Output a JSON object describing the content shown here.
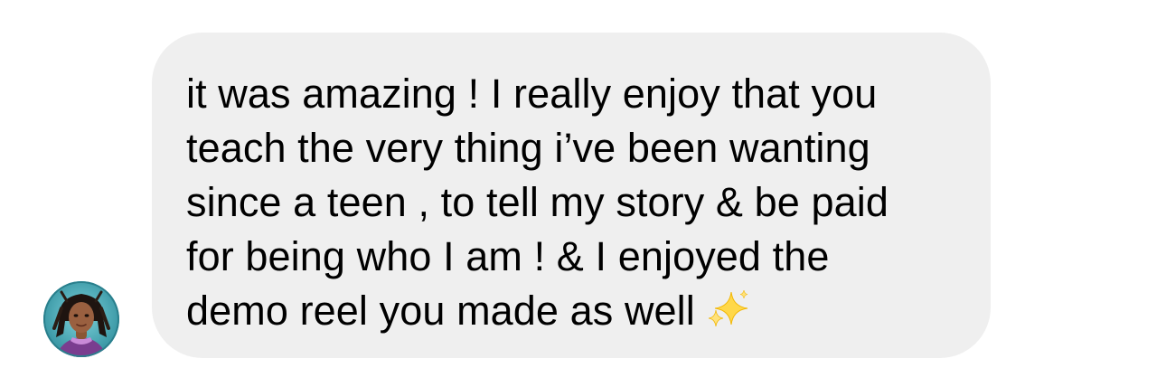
{
  "message": {
    "lines": [
      "it was amazing ! I really enjoy that you",
      "teach the very thing i’ve been wanting",
      "since a teen , to tell my story & be paid",
      "for being who I am ! & I enjoyed the",
      "demo reel you made as well"
    ],
    "emoji": "sparkles-icon",
    "bubble_color": "#efefef",
    "text_color": "#000000"
  },
  "sender": {
    "avatar": "avatar-illustration",
    "avatar_ring_color": "#3fa3b0"
  }
}
